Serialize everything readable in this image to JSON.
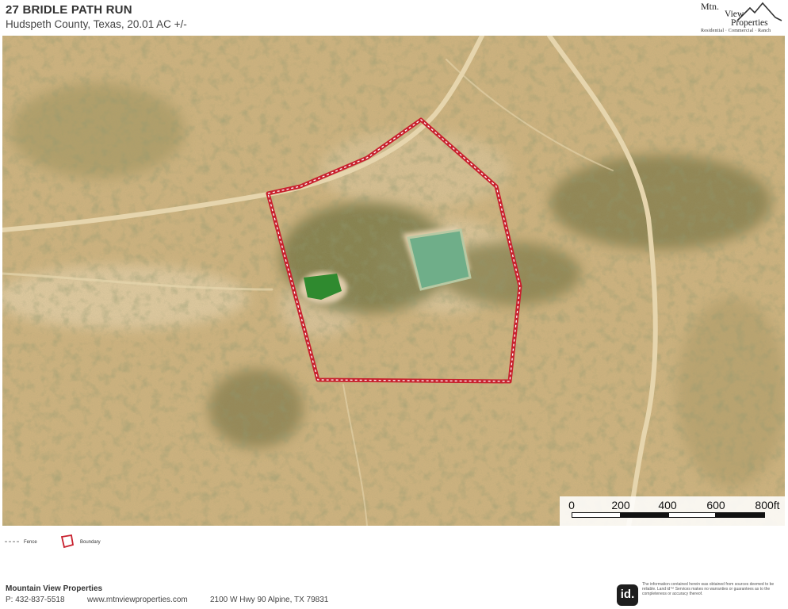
{
  "header": {
    "title": "27 BRIDLE PATH RUN",
    "subtitle": "Hudspeth County, Texas, 20.01 AC +/-"
  },
  "logo": {
    "line1": "Mtn.",
    "line2": "View",
    "line3": "Properties",
    "tagline": "Residential · Commercial · Ranch"
  },
  "map": {
    "type": "satellite-imagery",
    "colors": {
      "terrain": "#cdb27e",
      "vegetation": "#4f5a2e",
      "pond_water": "#6fb08a",
      "boundary": "#d0202e",
      "road": "#e3d2a8"
    }
  },
  "scale_bar": {
    "labels": [
      "0",
      "200",
      "400",
      "600",
      "800ft"
    ]
  },
  "legend": {
    "items": [
      {
        "label": "Fence",
        "icon": "fence-line-icon"
      },
      {
        "label": "Boundary",
        "icon": "boundary-polygon-icon"
      }
    ]
  },
  "footer": {
    "company": "Mountain View Properties",
    "phone": "P: 432-837-5518",
    "website": "www.mtnviewproperties.com",
    "address": "2100 W Hwy 90 Alpine, TX 79831",
    "badge": "id.",
    "disclaimer": "The information contained herein was obtained from sources deemed to be reliable. Land id™ Services makes no warranties or guarantees as to the completeness or accuracy thereof."
  }
}
